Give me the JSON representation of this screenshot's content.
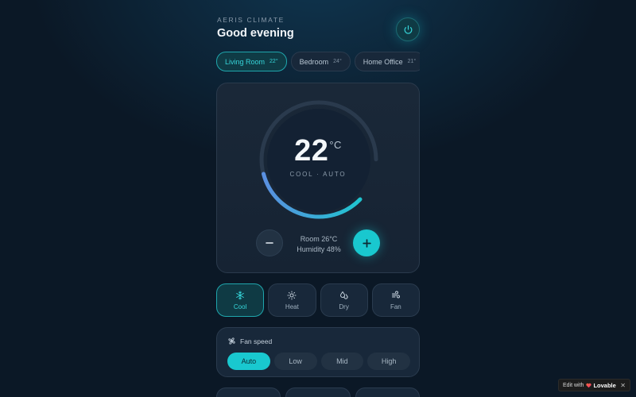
{
  "header": {
    "brand": "AERIS CLIMATE",
    "greeting": "Good evening"
  },
  "rooms": [
    {
      "name": "Living Room",
      "temp": "22°",
      "active": true
    },
    {
      "name": "Bedroom",
      "temp": "24°",
      "active": false
    },
    {
      "name": "Home Office",
      "temp": "21°",
      "active": false
    }
  ],
  "thermostat": {
    "setpoint": "22",
    "unit": "°C",
    "mode_text": "COOL · AUTO",
    "room_temp": "Room 26°C",
    "humidity": "Humidity 48%"
  },
  "modes": [
    {
      "label": "Cool",
      "icon": "snowflake-icon",
      "active": true
    },
    {
      "label": "Heat",
      "icon": "sun-icon",
      "active": false
    },
    {
      "label": "Dry",
      "icon": "droplets-icon",
      "active": false
    },
    {
      "label": "Fan",
      "icon": "wind-icon",
      "active": false
    }
  ],
  "fan": {
    "title": "Fan speed",
    "options": [
      "Auto",
      "Low",
      "Mid",
      "High"
    ],
    "selected": "Auto"
  },
  "badge": {
    "prefix": "Edit with",
    "brand": "Lovable"
  },
  "colors": {
    "accent": "#19c8cf",
    "background": "#0b1826",
    "card": "#18283a"
  }
}
